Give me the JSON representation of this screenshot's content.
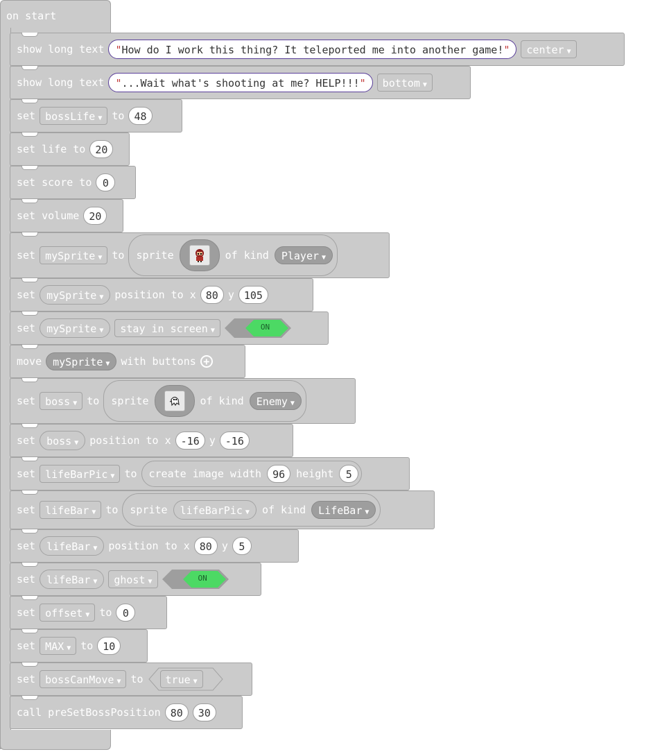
{
  "hat": {
    "label": "on start"
  },
  "rows": {
    "r1": {
      "kw": "show long text",
      "text": "How do I work this thing? It teleported me into another game!",
      "mode": "center"
    },
    "r2": {
      "kw": "show long text",
      "text": "...Wait what's shooting at me? HELP!!!",
      "mode": "bottom"
    },
    "r3": {
      "kw": "set",
      "var": "bossLife",
      "to": "to",
      "value": "48"
    },
    "r4": {
      "kw": "set life to",
      "value": "20"
    },
    "r5": {
      "kw": "set score to",
      "value": "0"
    },
    "r6": {
      "kw": "set volume",
      "value": "20"
    },
    "r7": {
      "kw": "set",
      "var": "mySprite",
      "to": "to",
      "sprite": "sprite",
      "of_kind": "of kind",
      "kind": "Player"
    },
    "r8": {
      "kw": "set",
      "var": "mySprite",
      "pos": "position to x",
      "x": "80",
      "y_label": "y",
      "y": "105"
    },
    "r9": {
      "kw": "set",
      "var": "mySprite",
      "prop": "stay in screen",
      "toggle": "ON"
    },
    "r10": {
      "kw": "move",
      "var": "mySprite",
      "rest": "with buttons"
    },
    "r11": {
      "kw": "set",
      "var": "boss",
      "to": "to",
      "sprite": "sprite",
      "of_kind": "of kind",
      "kind": "Enemy"
    },
    "r12": {
      "kw": "set",
      "var": "boss",
      "pos": "position to x",
      "x": "-16",
      "y_label": "y",
      "y": "-16"
    },
    "r13": {
      "kw": "set",
      "var": "lifeBarPic",
      "to": "to",
      "create": "create image width",
      "width": "96",
      "height_label": "height",
      "height": "5"
    },
    "r14": {
      "kw": "set",
      "var": "lifeBar",
      "to": "to",
      "sprite": "sprite",
      "img": "lifeBarPic",
      "of_kind": "of kind",
      "kind": "LifeBar"
    },
    "r15": {
      "kw": "set",
      "var": "lifeBar",
      "pos": "position to x",
      "x": "80",
      "y_label": "y",
      "y": "5"
    },
    "r16": {
      "kw": "set",
      "var": "lifeBar",
      "prop": "ghost",
      "toggle": "ON"
    },
    "r17": {
      "kw": "set",
      "var": "offset",
      "to": "to",
      "value": "0"
    },
    "r18": {
      "kw": "set",
      "var": "MAX",
      "to": "to",
      "value": "10"
    },
    "r19": {
      "kw": "set",
      "var": "bossCanMove",
      "to": "to",
      "value": "true"
    },
    "r20": {
      "kw": "call preSetBossPosition",
      "a": "80",
      "b": "30"
    }
  },
  "colors": {
    "block": "#cbcbcb",
    "border": "#a3a3a3",
    "dark": "#9e9e9e",
    "toggle_on": "#4cd964",
    "string_outline": "#5a3f9a",
    "quote": "#c23b3b"
  },
  "icons": {
    "dropdown": "triangle-down",
    "add": "circle-plus",
    "player_sprite": "red-hooded-character",
    "enemy_sprite": "white-ghost"
  }
}
